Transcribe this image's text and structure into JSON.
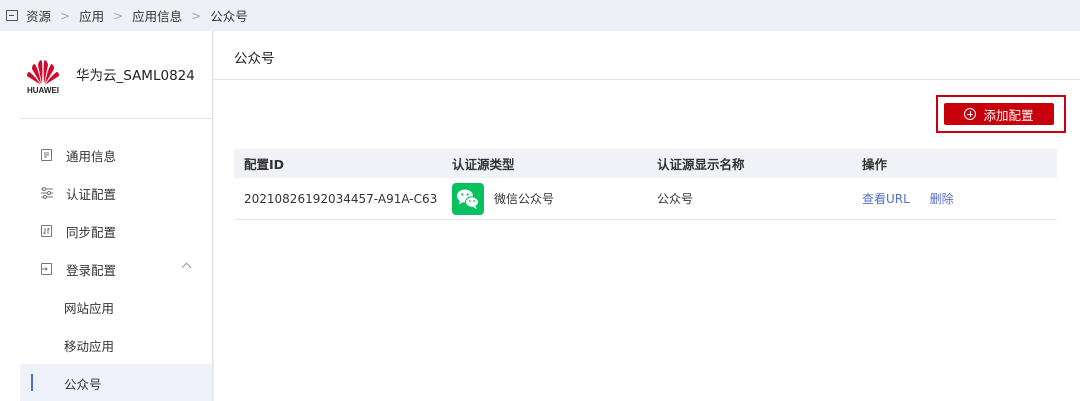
{
  "breadcrumb": {
    "items": [
      "资源",
      "应用",
      "应用信息",
      "公众号"
    ],
    "separator": ">"
  },
  "sidebar": {
    "brand": {
      "logo_text": "HUAWEI",
      "app_name": "华为云_SAML0824"
    },
    "items": [
      {
        "label": "通用信息",
        "icon": "document-icon"
      },
      {
        "label": "认证配置",
        "icon": "list-settings-icon"
      },
      {
        "label": "同步配置",
        "icon": "sync-icon"
      },
      {
        "label": "登录配置",
        "icon": "login-icon"
      }
    ],
    "sub_items": [
      {
        "label": "网站应用"
      },
      {
        "label": "移动应用"
      },
      {
        "label": "公众号"
      }
    ]
  },
  "main": {
    "title": "公众号",
    "add_button_label": "添加配置",
    "table": {
      "columns": [
        "配置ID",
        "认证源类型",
        "认证源显示名称",
        "操作"
      ],
      "rows": [
        {
          "id": "20210826192034457-A91A-C63",
          "type": "微信公众号",
          "display_name": "公众号",
          "actions": [
            "查看URL",
            "删除"
          ]
        }
      ]
    }
  },
  "colors": {
    "accent": "#526ecc",
    "danger": "#c7000b",
    "wechat": "#07c160",
    "huawei_red": "#cf0a2c"
  }
}
